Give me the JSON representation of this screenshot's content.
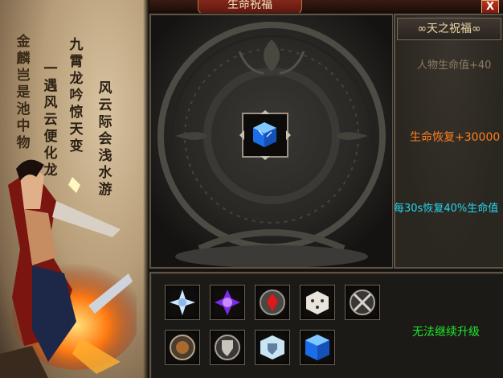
{
  "window": {
    "title": "生命祝福",
    "close_label": "X"
  },
  "poem": {
    "col1": "风云际会浅水游",
    "col2": "九霄龙吟惊天变",
    "col3": "一遇风云便化龙",
    "col4": "金麟岂是池中物"
  },
  "blessing": {
    "title": "∞天之祝福∞",
    "attr_hp": "人物生命值+40",
    "attr_regen": "生命恢复+30000",
    "attr_periodic": "每30s恢复40%生命值"
  },
  "upgrade": {
    "status": "无法继续升级",
    "items": [
      {
        "icon": "frost-crystal-icon"
      },
      {
        "icon": "purple-crystal-icon"
      },
      {
        "icon": "red-gem-icon"
      },
      {
        "icon": "dice-icon"
      },
      {
        "icon": "crossed-swords-icon"
      },
      {
        "icon": "bronze-medallion-icon"
      },
      {
        "icon": "shield-icon"
      },
      {
        "icon": "winged-shield-icon"
      },
      {
        "icon": "blue-cube-icon"
      }
    ]
  },
  "colors": {
    "accent_orange": "#ff7f1e",
    "accent_cyan": "#25d7ef",
    "status_green": "#1ee82e"
  }
}
